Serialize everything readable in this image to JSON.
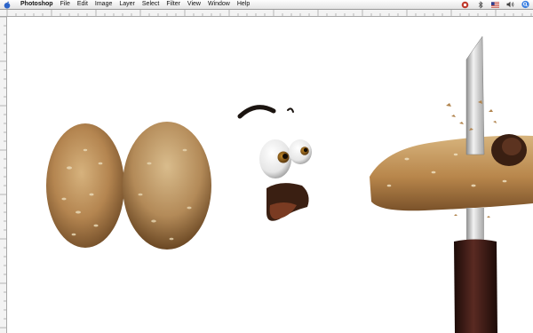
{
  "menubar": {
    "app_name": "Photoshop",
    "items": [
      "File",
      "Edit",
      "Image",
      "Layer",
      "Select",
      "Filter",
      "View",
      "Window",
      "Help"
    ],
    "tray_icons": [
      "app-status-icon",
      "bluetooth-icon",
      "flag-us-icon",
      "volume-icon",
      "search-icon"
    ]
  },
  "canvas": {
    "subject": "bread-characters",
    "colors": {
      "crust": "#b58a55",
      "crust_dark": "#7a5630",
      "knife_handle": "#3a1a14",
      "blade": "#c9c9c9"
    }
  }
}
